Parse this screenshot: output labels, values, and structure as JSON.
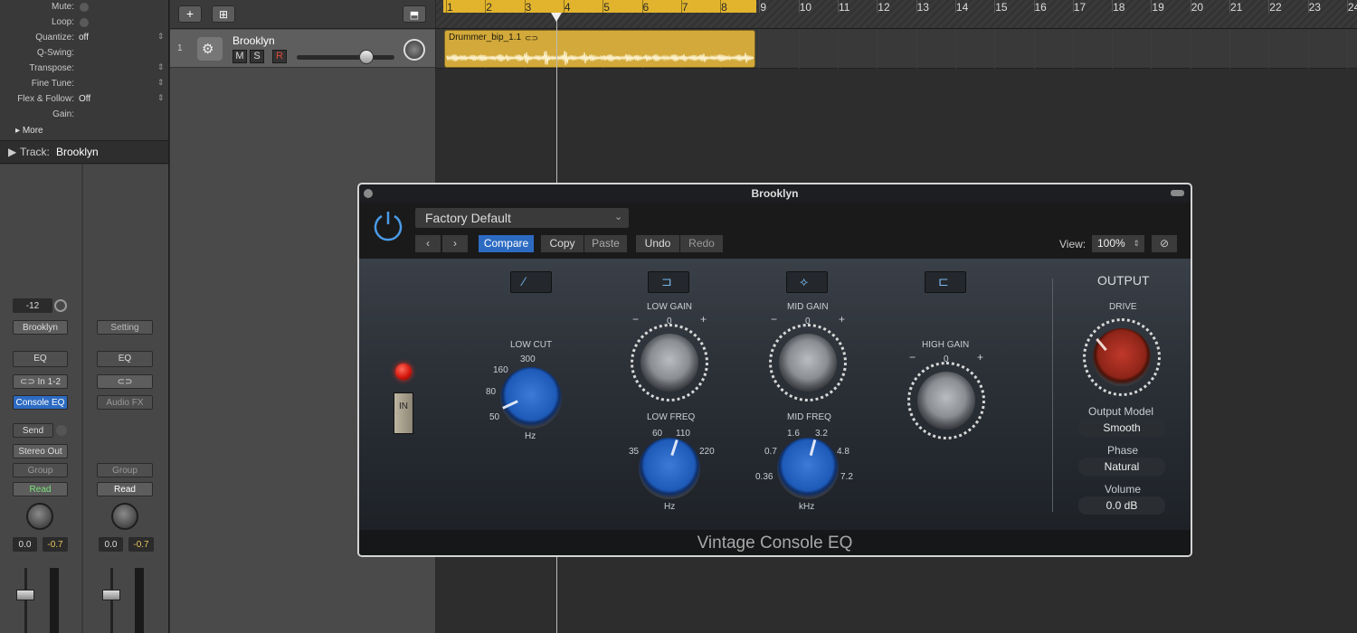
{
  "inspector": {
    "region_rows": [
      {
        "label": "Mute:",
        "value": "",
        "type": "checkbox"
      },
      {
        "label": "Loop:",
        "value": "",
        "type": "checkbox"
      },
      {
        "label": "Quantize:",
        "value": "off",
        "type": "popup"
      },
      {
        "label": "Q-Swing:",
        "value": "",
        "type": "text"
      },
      {
        "label": "Transpose:",
        "value": "",
        "type": "popup"
      },
      {
        "label": "Fine Tune:",
        "value": "",
        "type": "popup"
      },
      {
        "label": "Flex & Follow:",
        "value": "Off",
        "type": "popup"
      },
      {
        "label": "Gain:",
        "value": "",
        "type": "text"
      }
    ],
    "more_label": "More",
    "track_header": {
      "prefix": "Track:",
      "name": "Brooklyn"
    },
    "strip1": {
      "volume": "-12",
      "name": "Brooklyn",
      "eq": "EQ",
      "input": "In 1-2",
      "plugin": "Console EQ",
      "send": "Send",
      "output": "Stereo Out",
      "group": "Group",
      "automation": "Read",
      "pan_val": "0.0",
      "peak_val": "-0.7"
    },
    "strip2": {
      "setting": "Setting",
      "eq": "EQ",
      "fx": "Audio FX",
      "group": "Group",
      "automation": "Read",
      "pan_val": "0.0",
      "peak_val": "-0.7"
    }
  },
  "tracks": {
    "track": {
      "number": "1",
      "name": "Brooklyn",
      "mute": "M",
      "solo": "S",
      "record": "R"
    }
  },
  "timeline": {
    "bars": [
      "1",
      "2",
      "3",
      "4",
      "5",
      "6",
      "7",
      "8",
      "9",
      "10",
      "11",
      "12",
      "13",
      "14",
      "15",
      "16",
      "17",
      "18",
      "19",
      "20",
      "21",
      "22",
      "23",
      "24"
    ],
    "region_name": "Drummer_bip_1.1",
    "cycle_color": "#e2b42d",
    "region_color": "#d2a93a"
  },
  "plugin": {
    "window_title": "Brooklyn",
    "preset": "Factory Default",
    "buttons": {
      "prev": "‹",
      "next": "›",
      "compare": "Compare",
      "copy": "Copy",
      "paste": "Paste",
      "undo": "Undo",
      "redo": "Redo"
    },
    "view_label": "View:",
    "view_value": "100%",
    "in_label": "IN",
    "low_cut": {
      "label": "LOW CUT",
      "ticks": [
        "50",
        "80",
        "160",
        "300"
      ],
      "unit": "Hz"
    },
    "low_gain": {
      "label": "LOW GAIN",
      "minus": "−",
      "zero": "0",
      "plus": "+"
    },
    "low_freq": {
      "label": "LOW FREQ",
      "ticks": [
        "35",
        "60",
        "110",
        "220"
      ],
      "unit": "Hz"
    },
    "mid_gain": {
      "label": "MID GAIN",
      "minus": "−",
      "zero": "0",
      "plus": "+"
    },
    "mid_freq": {
      "label": "MID FREQ",
      "ticks": [
        "0.36",
        "0.7",
        "1.6",
        "3.2",
        "4.8",
        "7.2"
      ],
      "unit": "kHz"
    },
    "high_gain": {
      "label": "HIGH GAIN",
      "minus": "−",
      "zero": "0",
      "plus": "+"
    },
    "output": {
      "title": "OUTPUT",
      "drive": "DRIVE",
      "model_label": "Output Model",
      "model_value": "Smooth",
      "phase_label": "Phase",
      "phase_value": "Natural",
      "volume_label": "Volume",
      "volume_value": "0.0 dB"
    },
    "footer": "Vintage Console EQ",
    "accent_blue": "#2d6bc2",
    "power_color": "#4a9be8"
  }
}
